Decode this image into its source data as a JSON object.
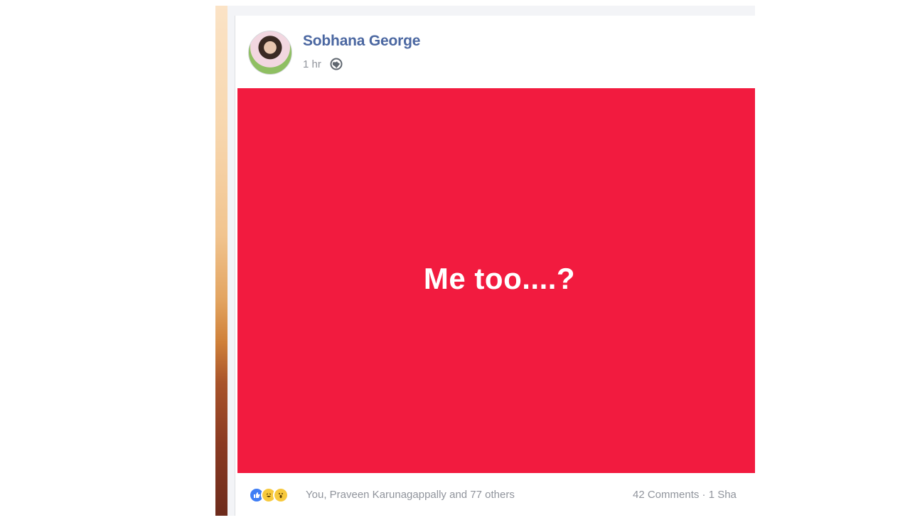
{
  "post": {
    "author": "Sobhana George",
    "timestamp": "1 hr",
    "privacy_icon": "globe-icon",
    "content_text": "Me too....?",
    "background_color": "#f21b3f",
    "reaction_icons": [
      "like-icon",
      "haha-icon",
      "wow-icon"
    ],
    "reactors": "You, Praveen Karunagappally and 77 others",
    "stats": "42 Comments · 1 Sha"
  }
}
